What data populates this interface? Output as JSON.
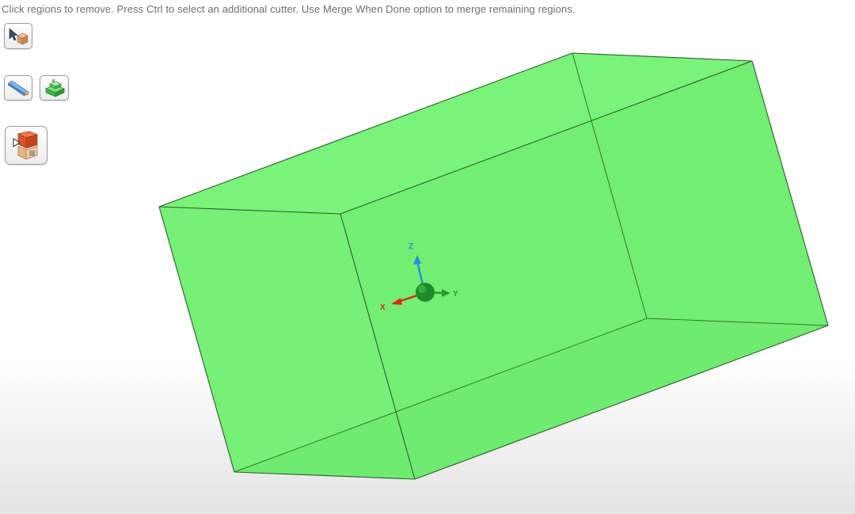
{
  "hint": {
    "text": "Click regions to remove. Press Ctrl to select an additional cutter. Use Merge When Done option to merge remaining regions."
  },
  "toolbar": {
    "buttons": [
      {
        "icon": "cursor-select-box-icon"
      },
      {
        "icon": "rod-tool-icon"
      },
      {
        "icon": "green-block-tool-icon"
      },
      {
        "icon": "done-merge-icon"
      }
    ]
  },
  "scene": {
    "body_color": "#72ee72",
    "edge_color": "#1f6b1f"
  },
  "triad": {
    "x_label": "X",
    "y_label": "Y",
    "z_label": "Z",
    "x_color": "#e0241c",
    "y_color": "#2a9a2a",
    "z_color": "#2a8ee0"
  }
}
